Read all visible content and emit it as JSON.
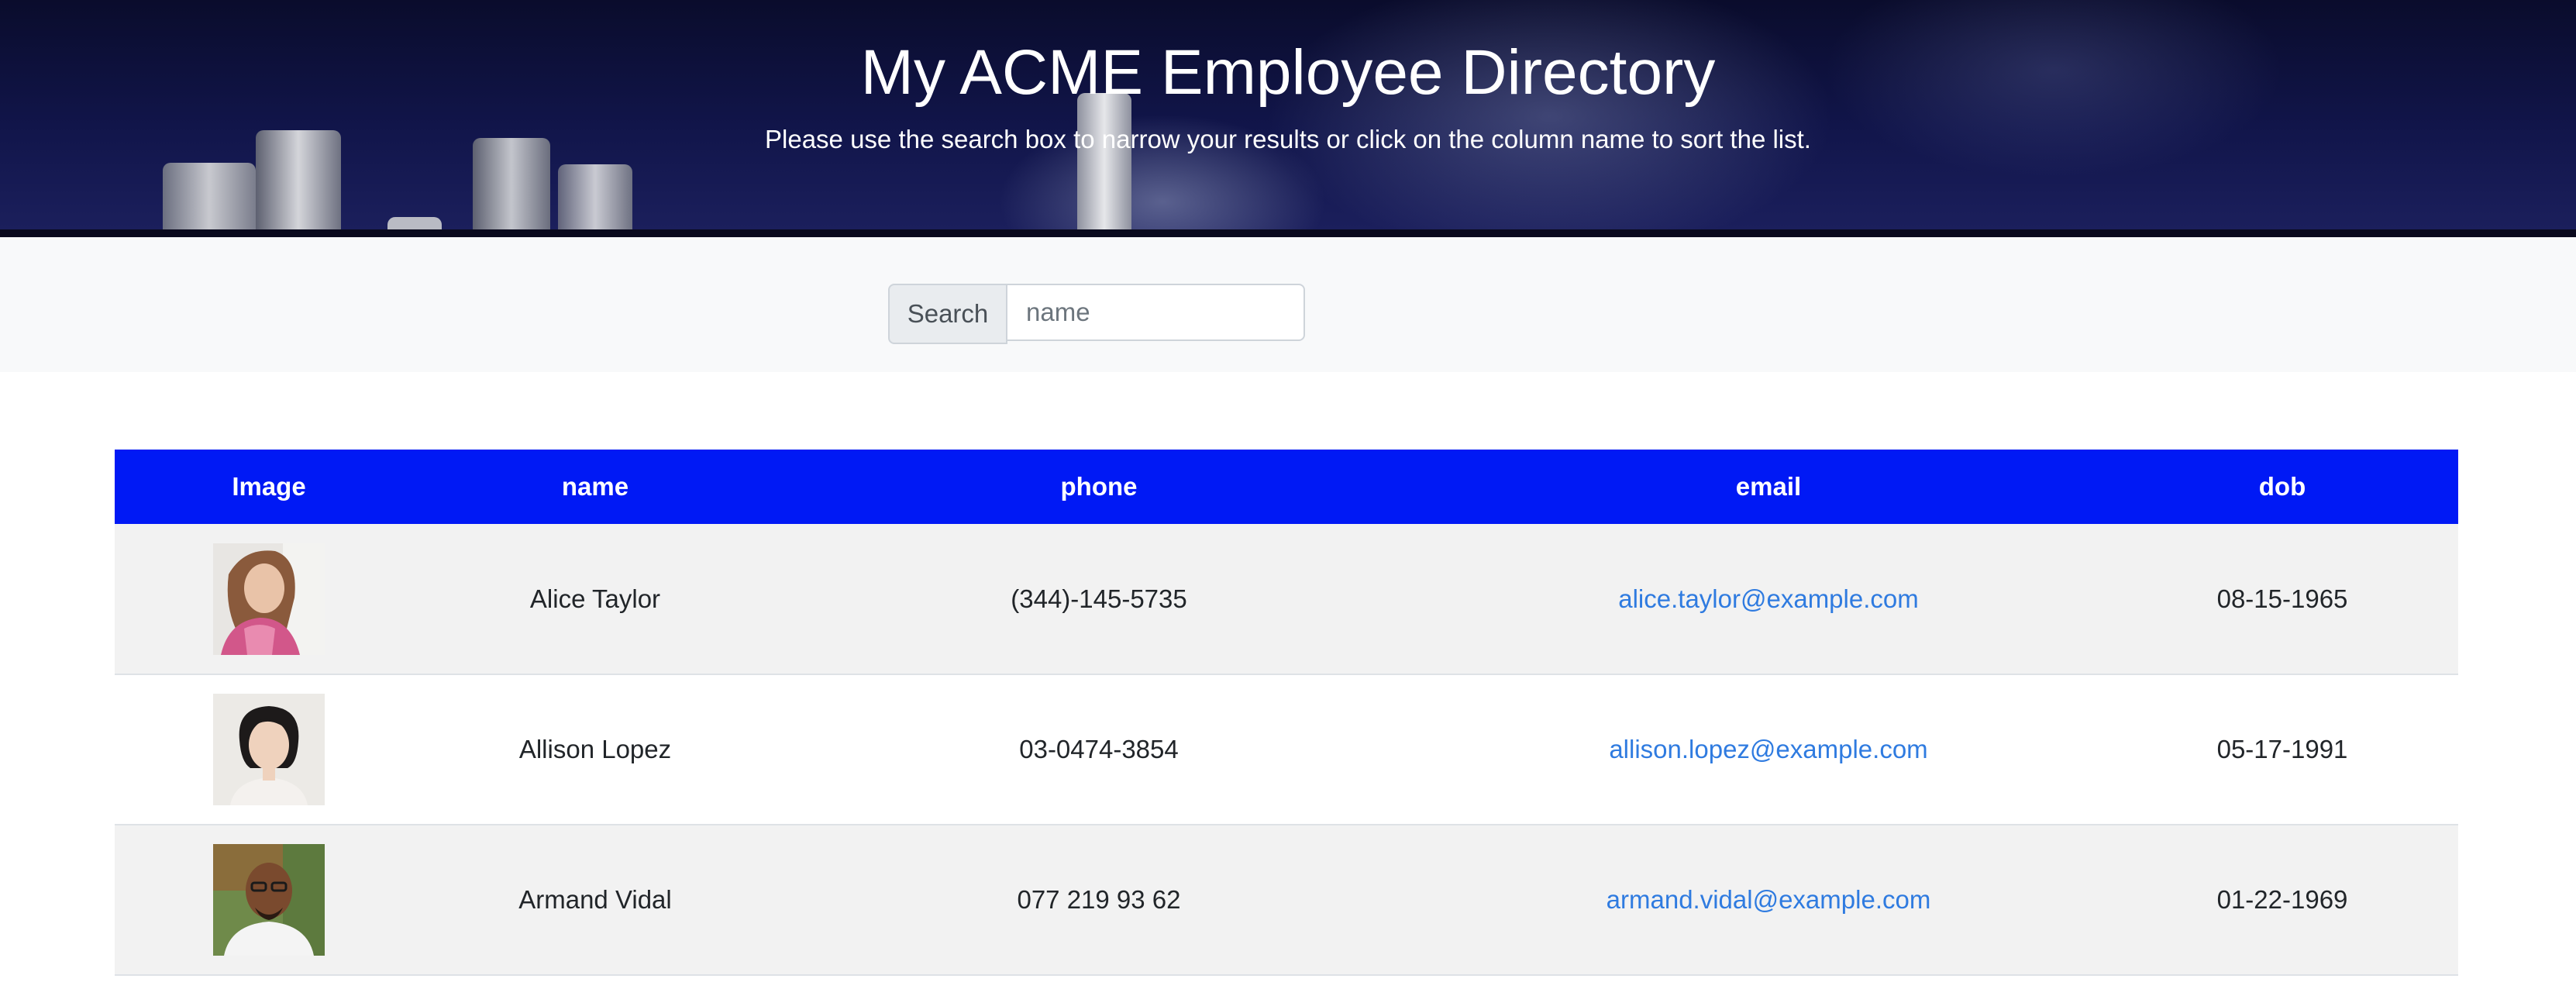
{
  "header": {
    "title": "My ACME Employee Directory",
    "subtitle": "Please use the search box to narrow your results or click on the column name to sort the list."
  },
  "search": {
    "label": "Search",
    "placeholder": "name",
    "value": ""
  },
  "table": {
    "header_color": "#0019f5",
    "link_color": "#2f7be0",
    "columns": [
      "Image",
      "name",
      "phone",
      "email",
      "dob"
    ],
    "rows": [
      {
        "avatar": "woman-portrait-pink-jacket",
        "name": "Alice Taylor",
        "phone": "(344)-145-5735",
        "email": "alice.taylor@example.com",
        "dob": "08-15-1965"
      },
      {
        "avatar": "woman-portrait-short-hair",
        "name": "Allison Lopez",
        "phone": "03-0474-3854",
        "email": "allison.lopez@example.com",
        "dob": "05-17-1991"
      },
      {
        "avatar": "man-portrait-glasses",
        "name": "Armand Vidal",
        "phone": "077 219 93 62",
        "email": "armand.vidal@example.com",
        "dob": "01-22-1969"
      }
    ]
  }
}
